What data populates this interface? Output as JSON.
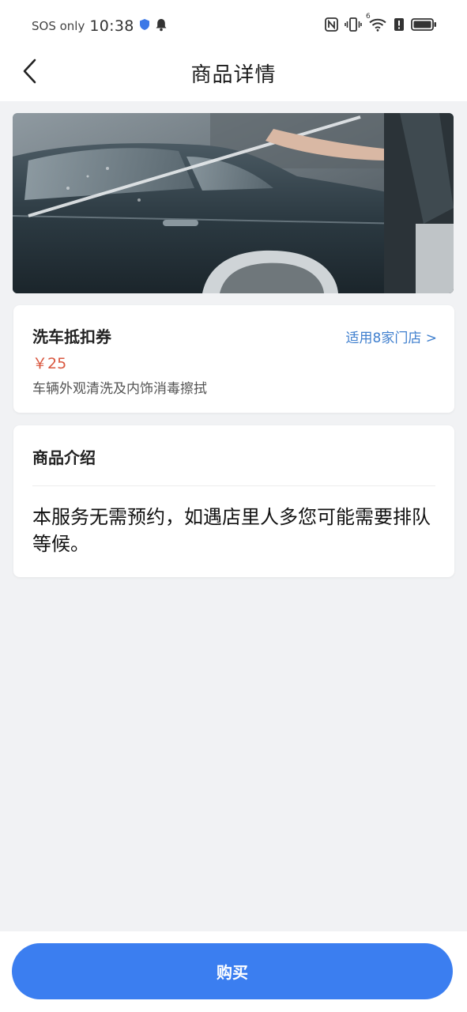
{
  "status_bar": {
    "carrier": "SOS only",
    "time": "10:38",
    "left_icons": [
      "shield-icon",
      "bell-icon"
    ],
    "right_icons": [
      "nfc-icon",
      "vibrate-icon",
      "wifi-icon",
      "alert-icon",
      "battery-icon"
    ],
    "wifi_badge": "6"
  },
  "nav": {
    "back_icon": "chevron-left-icon",
    "title": "商品详情"
  },
  "banner": {
    "image": "car-wash-photo"
  },
  "product": {
    "name": "洗车抵扣券",
    "stores_link": "适用8家门店 >",
    "price": "￥25",
    "description": "车辆外观清洗及内饰消毒擦拭"
  },
  "intro": {
    "heading": "商品介绍",
    "body": "本服务无需预约，如遇店里人多您可能需要排队等候。"
  },
  "footer": {
    "buy_label": "购买"
  },
  "colors": {
    "accent": "#3b7ef0",
    "link": "#3f7fce",
    "price": "#d9573f",
    "background": "#f1f2f4"
  }
}
